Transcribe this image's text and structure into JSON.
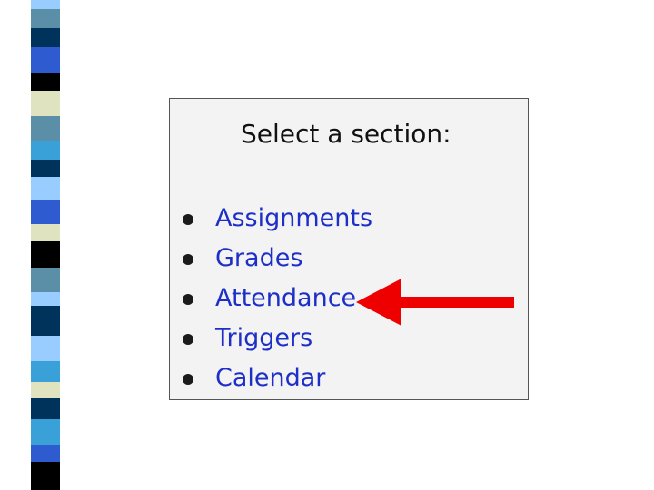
{
  "panel": {
    "title": "Select a section:"
  },
  "menu": {
    "items": [
      {
        "label": "Assignments"
      },
      {
        "label": "Grades"
      },
      {
        "label": "Attendance"
      },
      {
        "label": "Triggers"
      },
      {
        "label": "Calendar"
      }
    ]
  },
  "annotation": {
    "arrow_color": "#ee0000",
    "points_to": "Attendance"
  },
  "colors": {
    "link": "#1e2fc8",
    "panel_bg": "#f3f3f3",
    "stripe": [
      "#5b8fa8",
      "#00335c",
      "#2f5bd1",
      "#000000",
      "#dfe3c0",
      "#3aa0d8",
      "#99ccff"
    ]
  }
}
